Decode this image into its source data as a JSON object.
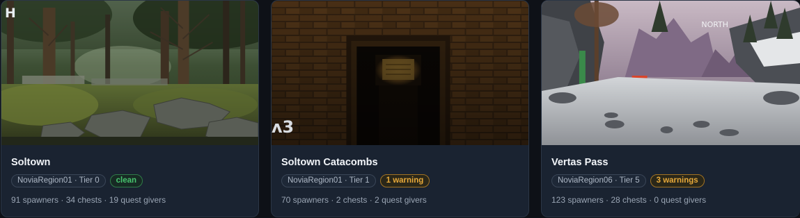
{
  "cards": [
    {
      "title": "Soltown",
      "region_tier": "NoviaRegion01 · Tier 0",
      "status": "clean",
      "stats": "91 spawners · 34 chests · 19 quest givers",
      "thumb_overlay": "H"
    },
    {
      "title": "Soltown Catacombs",
      "region_tier": "NoviaRegion01 · Tier 1",
      "status": "1 warning",
      "stats": "70 spawners · 2 chests · 2 quest givers",
      "thumb_overlay": "ᴧ3"
    },
    {
      "title": "Vertas Pass",
      "region_tier": "NoviaRegion06 · Tier 5",
      "status": "3 warnings",
      "stats": "123 spawners · 28 chests · 0 quest givers",
      "thumb_overlay": "NORTH"
    }
  ],
  "colors": {
    "page_bg": "#0e1117",
    "card_bg": "#1a2331",
    "clean": "#47c46e",
    "warning": "#e7a93a"
  },
  "icons": [
    "forest-scene",
    "catacomb-doorway-scene",
    "snowy-pass-scene"
  ]
}
